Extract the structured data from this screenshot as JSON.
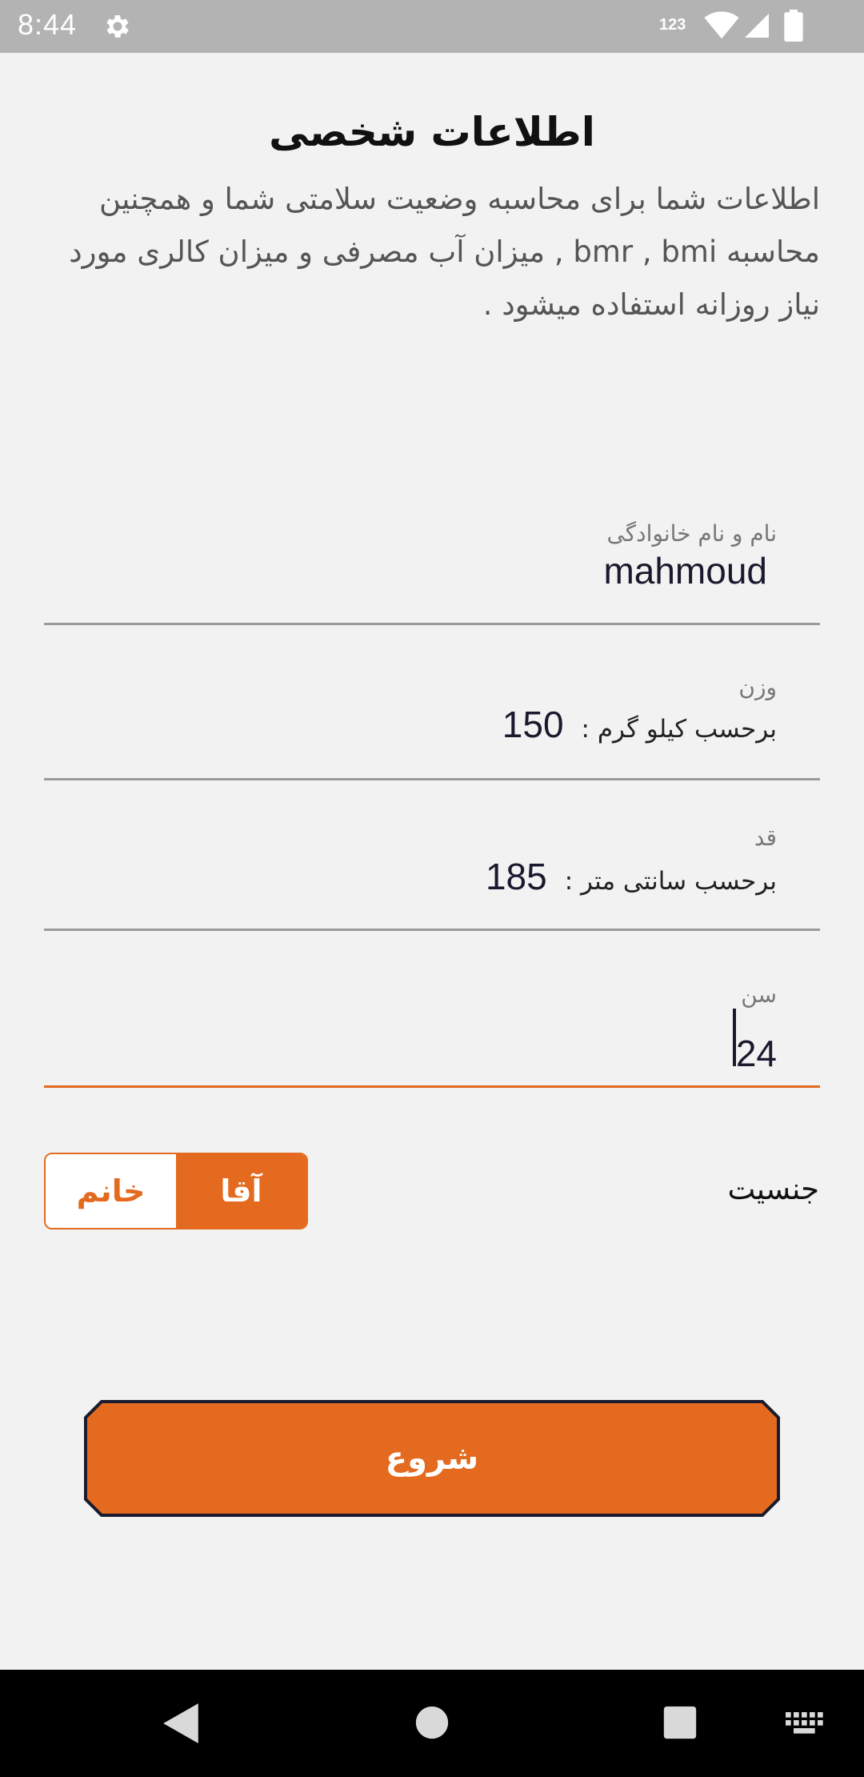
{
  "status_bar": {
    "time": "8:44",
    "input_mode": "123",
    "icons": [
      "gear-icon",
      "wifi-icon",
      "signal-icon",
      "battery-icon"
    ]
  },
  "page": {
    "title": "اطلاعات شخصی",
    "description": "اطلاعات شما برای محاسبه وضعیت سلامتی شما و همچنین محاسبه bmr , bmi , میزان آب مصرفی و میزان کالری مورد نیاز روزانه استفاده میشود ."
  },
  "form": {
    "name": {
      "label": "نام و نام خانوادگی",
      "value": "mahmoud"
    },
    "weight": {
      "label": "وزن",
      "prefix": "برحسب کیلو گرم :",
      "value": "150"
    },
    "height": {
      "label": "قد",
      "prefix": "برحسب سانتی متر :",
      "value": "185"
    },
    "age": {
      "label": "سن",
      "value": "24"
    },
    "gender": {
      "label": "جنسیت",
      "options": {
        "male": "آقا",
        "female": "خانم"
      },
      "selected": "آقا"
    },
    "start_label": "شروع"
  },
  "colors": {
    "accent": "#e36a1e",
    "background": "#f2f2f2",
    "status_bar": "#b3b3b3",
    "nav_bar": "#000000",
    "button_border": "#1b1b2f"
  },
  "nav_bar": {
    "icons": [
      "back-icon",
      "home-icon",
      "recents-icon",
      "keyboard-icon"
    ]
  }
}
